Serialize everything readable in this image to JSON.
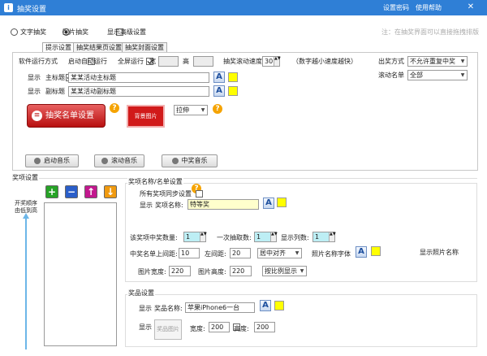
{
  "window": {
    "title": "抽奖设置",
    "link1": "设置密码",
    "link2": "使用帮助"
  },
  "top": {
    "radio1": "文字抽奖",
    "radio2": "图片抽奖",
    "show_advanced": "显示高级设置",
    "note": "注：在抽奖界面可以直接拖拽排版"
  },
  "tabs": [
    "提示设置",
    "抽奖结果页设置",
    "抽奖封面设置"
  ],
  "cover": {
    "run_mode_label": "软件运行方式",
    "auto_run": "启动自动运行",
    "fullscreen": "全屏运行",
    "width_label": "宽",
    "height_label": "高",
    "speed_label": "抽奖滚动速度",
    "speed_value": "30",
    "speed_hint": "（数字越小速度越快）",
    "title_show": "显示",
    "title_label": "主标题",
    "title_value": "某某活动主标题",
    "subtitle_show": "显示",
    "subtitle_label": "副标题",
    "subtitle_value": "某某活动副标题",
    "list_button": "抽奖名单设置",
    "bg_button": "背景图片",
    "stretch_value": "拉伸",
    "out_mode_label": "出奖方式",
    "out_mode_value": "不允许重复中奖",
    "scroll_list_label": "滚动名单",
    "scroll_list_value": "全部",
    "music1": "启动音乐",
    "music2": "滚动音乐",
    "music3": "中奖音乐"
  },
  "prizes": {
    "section_title": "奖项设置",
    "order_label": "开奖顺序由低到高",
    "name_group_title": "奖项名称/名单设置",
    "sync_all": "所有奖项同步设置",
    "name_show": "显示",
    "name_label": "奖项名称:",
    "name_value": "特等奖",
    "count_label": "该奖项中奖数量:",
    "count_value": "1",
    "once_label": "一次抽取数:",
    "once_value": "1",
    "cols_label": "显示列数:",
    "cols_value": "1",
    "top_margin_label": "中奖名单上间距:",
    "top_margin_value": "10",
    "left_margin_label": "左间距:",
    "left_margin_value": "20",
    "align_value": "居中对齐",
    "photo_font_label": "照片名称字体",
    "show_photo_name": "显示照片名称",
    "img_w_label": "图片宽度:",
    "img_w_value": "220",
    "img_h_label": "图片高度:",
    "img_h_value": "220",
    "scale_value": "按比例显示",
    "goods_title": "奖品设置",
    "goods_show": "显示",
    "goods_name_label": "奖品名称:",
    "goods_name_value": "苹果iPhone6一台",
    "goods_show2": "显示",
    "goods_img_button": "奖品图片",
    "goods_w_label": "宽度:",
    "goods_w_value": "200",
    "goods_h_label": "高度:",
    "goods_h_value": "200"
  }
}
